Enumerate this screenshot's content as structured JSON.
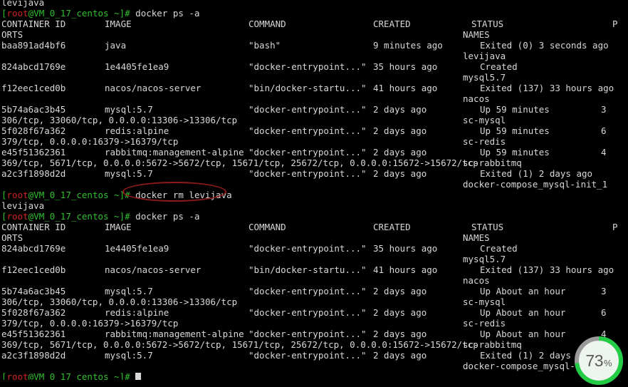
{
  "terminal": {
    "prompt": {
      "bracket_open": "[",
      "user": "root",
      "host_tail": "@VM_0_17_centos ~]#",
      "full": "[root@VM_0_17_centos ~]#"
    },
    "clipped_top_line": "levijava",
    "commands": {
      "ps_a": " docker ps -a",
      "rm_levijava": " docker rm levijava",
      "cursor": " "
    },
    "rm_output": "levijava",
    "headers": {
      "container_id": "CONTAINER ID",
      "image": "IMAGE",
      "command": "COMMAND",
      "created": "CREATED",
      "status": "STATUS",
      "p": "P",
      "orts": "ORTS",
      "names": "NAMES"
    },
    "first_ps": {
      "rows": [
        {
          "id": "baa891ad4bf6",
          "image": "java",
          "command": "\"bash\"",
          "created": "9 minutes ago",
          "status": "Exited (0) 3 seconds ago",
          "port_num": "",
          "names": "levijava",
          "ports": ""
        },
        {
          "id": "824abcd1769e",
          "image": "1e4405fe1ea9",
          "command": "\"docker-entrypoint...\"",
          "created": "35 hours ago",
          "status": "Created",
          "port_num": "",
          "names": "mysql5.7",
          "ports": ""
        },
        {
          "id": "f12eec1ced0b",
          "image": "nacos/nacos-server",
          "command": "\"bin/docker-startu...\"",
          "created": "41 hours ago",
          "status": "Exited (137) 33 hours ago",
          "port_num": "",
          "names": "nacos",
          "ports": ""
        },
        {
          "id": "5b74a6ac3b45",
          "image": "mysql:5.7",
          "command": "\"docker-entrypoint...\"",
          "created": "2 days ago",
          "status": "Up 59 minutes",
          "port_num": "3",
          "names": "sc-mysql",
          "ports": "306/tcp, 33060/tcp, 0.0.0.0:13306->13306/tcp"
        },
        {
          "id": "5f028f67a362",
          "image": "redis:alpine",
          "command": "\"docker-entrypoint...\"",
          "created": "2 days ago",
          "status": "Up 59 minutes",
          "port_num": "6",
          "names": "sc-redis",
          "ports": "379/tcp, 0.0.0.0:16379->16379/tcp"
        },
        {
          "id": "e45f51362361",
          "image": "rabbitmq:management-alpine",
          "command": "\"docker-entrypoint...\"",
          "created": "2 days ago",
          "status": "Up 59 minutes",
          "port_num": "4",
          "names": "sc-rabbitmq",
          "ports": "369/tcp, 5671/tcp, 0.0.0.0:5672->5672/tcp, 15671/tcp, 25672/tcp, 0.0.0.0:15672->15672/tcp"
        },
        {
          "id": "a2c3f1898d2d",
          "image": "mysql:5.7",
          "command": "\"docker-entrypoint...\"",
          "created": "2 days ago",
          "status": "Exited (1) 2 days ago",
          "port_num": "",
          "names": "docker-compose_mysql-init_1",
          "ports": ""
        }
      ]
    },
    "second_ps": {
      "rows": [
        {
          "id": "824abcd1769e",
          "image": "1e4405fe1ea9",
          "command": "\"docker-entrypoint...\"",
          "created": "35 hours ago",
          "status": "Created",
          "port_num": "",
          "names": "mysql5.7",
          "ports": ""
        },
        {
          "id": "f12eec1ced0b",
          "image": "nacos/nacos-server",
          "command": "\"bin/docker-startu...\"",
          "created": "41 hours ago",
          "status": "Exited (137) 33 hours ago",
          "port_num": "",
          "names": "nacos",
          "ports": ""
        },
        {
          "id": "5b74a6ac3b45",
          "image": "mysql:5.7",
          "command": "\"docker-entrypoint...\"",
          "created": "2 days ago",
          "status": "Up About an hour",
          "port_num": "3",
          "names": "sc-mysql",
          "ports": "306/tcp, 33060/tcp, 0.0.0.0:13306->13306/tcp"
        },
        {
          "id": "5f028f67a362",
          "image": "redis:alpine",
          "command": "\"docker-entrypoint...\"",
          "created": "2 days ago",
          "status": "Up About an hour",
          "port_num": "6",
          "names": "sc-redis",
          "ports": "379/tcp, 0.0.0.0:16379->16379/tcp"
        },
        {
          "id": "e45f51362361",
          "image": "rabbitmq:management-alpine",
          "command": "\"docker-entrypoint...\"",
          "created": "2 days ago",
          "status": "Up About an hour",
          "port_num": "4",
          "names": "sc-rabbitmq",
          "ports": "369/tcp, 5671/tcp, 0.0.0.0:5672->5672/tcp, 15671/tcp, 25672/tcp, 0.0.0.0:15672->15672/tcp"
        },
        {
          "id": "a2c3f1898d2d",
          "image": "mysql:5.7",
          "command": "\"docker-entrypoint...\"",
          "created": "2 days ago",
          "status": "Exited (1) 2 days ago",
          "port_num": "",
          "names": "docker-compose_mysql-init",
          "ports": ""
        }
      ]
    }
  },
  "annotation": {
    "shape": "ellipse",
    "color": "#8e1b1b",
    "target_text": "docker rm levijava"
  },
  "cpu_badge": {
    "value": "73",
    "unit": "%",
    "percent": 73,
    "ring_color": "#22cc44",
    "track_color": "#8a8a8a",
    "face_color": "#eef4ee"
  }
}
